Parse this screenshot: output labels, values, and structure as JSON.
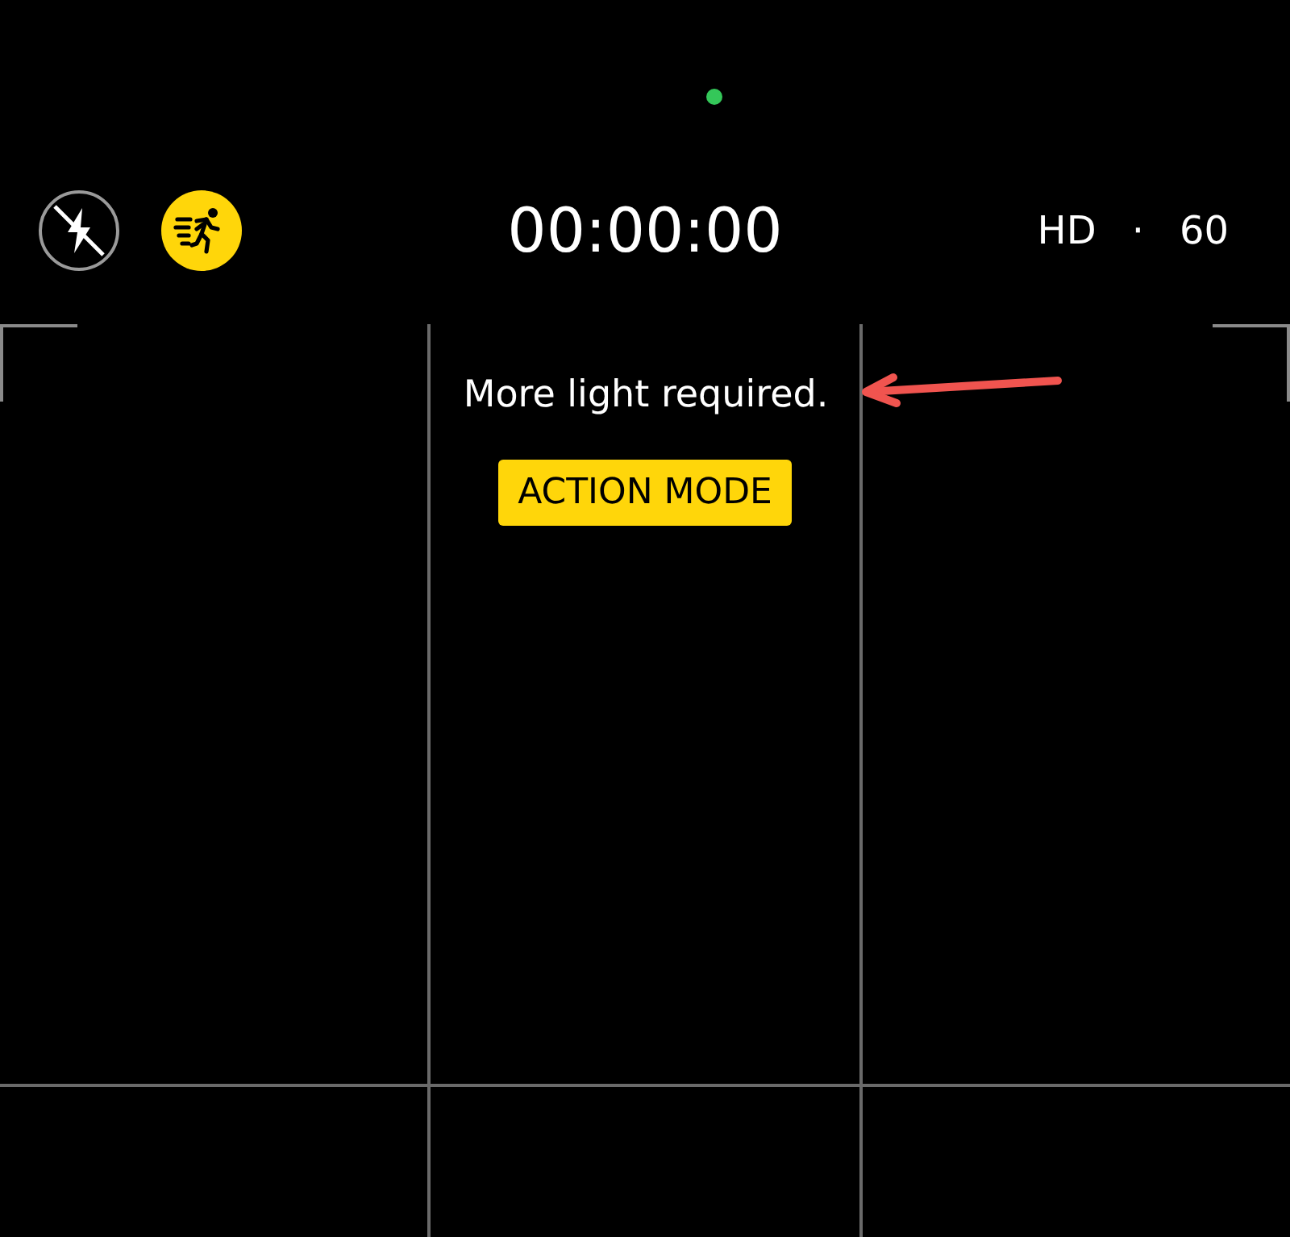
{
  "camera_indicator": {
    "color": "#34c759"
  },
  "top_bar": {
    "flash": {
      "on": false
    },
    "action_mode": {
      "on": true
    },
    "timer": "00:00:00",
    "resolution": "HD",
    "separator": "·",
    "frame_rate": "60"
  },
  "viewfinder": {
    "message": "More light required.",
    "mode_badge": "ACTION MODE"
  }
}
